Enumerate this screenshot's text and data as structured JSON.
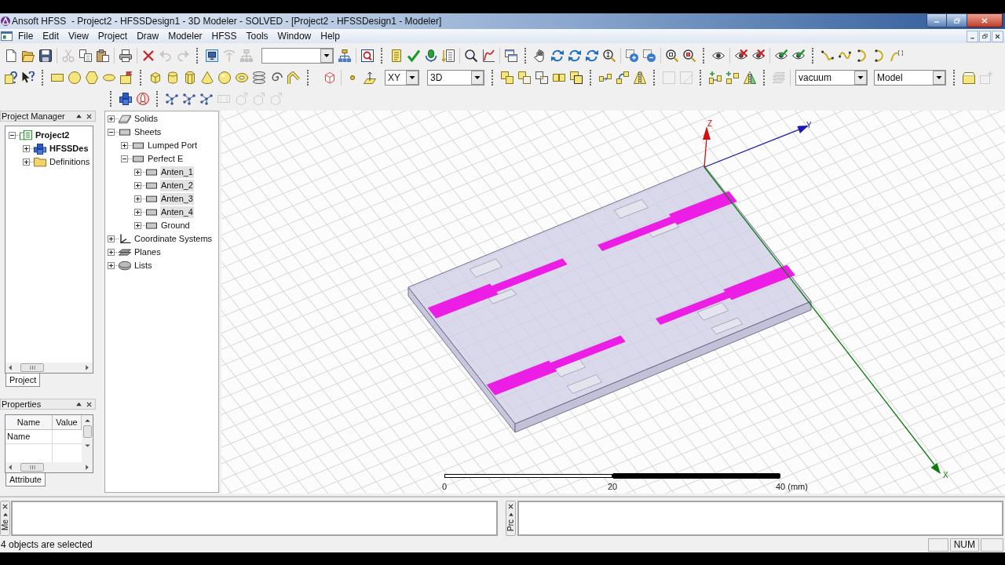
{
  "window": {
    "title": "Ansoft HFSS  - Project2 - HFSSDesign1 - 3D Modeler - SOLVED - [Project2 - HFSSDesign1 - Modeler]"
  },
  "menu": [
    "File",
    "Edit",
    "View",
    "Project",
    "Draw",
    "Modeler",
    "HFSS",
    "Tools",
    "Window",
    "Help"
  ],
  "toolbar": {
    "toggle_buttons": [
      {
        "pressed": true
      }
    ],
    "plane": "XY",
    "view": "3D",
    "material": "vacuum",
    "model_type": "Model"
  },
  "project_manager": {
    "title": "Project Manager",
    "tree": [
      {
        "label": "Project2",
        "kind": "project",
        "expanded": true,
        "selected": false,
        "children": [
          {
            "label": "HFSSDes",
            "kind": "design",
            "expanded": false,
            "selected": false
          },
          {
            "label": "Definitions",
            "kind": "definitions",
            "expanded": false,
            "selected": false
          }
        ]
      }
    ],
    "tabs": [
      {
        "label": "Project",
        "selected": true
      }
    ]
  },
  "properties": {
    "title": "Properties",
    "columns": [
      "Name",
      "Value"
    ],
    "rows": [
      {
        "name": "Name"
      }
    ],
    "tabs": [
      {
        "label": "Attribute",
        "selected": true
      }
    ]
  },
  "model_tree": [
    {
      "label": "Solids",
      "kind": "solids",
      "expanded": false,
      "selected": false
    },
    {
      "label": "Sheets",
      "kind": "sheets",
      "expanded": true,
      "selected": false,
      "children": [
        {
          "label": "Lumped Port",
          "kind": "sheet",
          "expanded": false,
          "selected": false
        },
        {
          "label": "Perfect E",
          "kind": "sheet",
          "expanded": true,
          "selected": false,
          "children": [
            {
              "label": "Anten_1",
              "kind": "sheet",
              "expanded": false,
              "selected": true
            },
            {
              "label": "Anten_2",
              "kind": "sheet",
              "expanded": false,
              "selected": true
            },
            {
              "label": "Anten_3",
              "kind": "sheet",
              "expanded": false,
              "selected": true
            },
            {
              "label": "Anten_4",
              "kind": "sheet",
              "expanded": false,
              "selected": true
            },
            {
              "label": "Ground",
              "kind": "sheet",
              "expanded": false,
              "selected": false
            }
          ]
        }
      ]
    },
    {
      "label": "Coordinate Systems",
      "kind": "coordinate_systems",
      "expanded": false,
      "selected": false
    },
    {
      "label": "Planes",
      "kind": "planes",
      "expanded": false,
      "selected": false
    },
    {
      "label": "Lists",
      "kind": "lists",
      "expanded": false,
      "selected": false
    }
  ],
  "viewport": {
    "axes": [
      {
        "label": "Z"
      },
      {
        "label": "Y"
      },
      {
        "label": "X"
      }
    ],
    "scale_labels": [
      "0",
      "20",
      "40 (mm)"
    ]
  },
  "message_pane": {
    "tab": "Me"
  },
  "progress_pane": {
    "tab": "Prc"
  },
  "status_bar": {
    "message": "4 objects are selected",
    "indicators": [
      "NUM"
    ]
  }
}
